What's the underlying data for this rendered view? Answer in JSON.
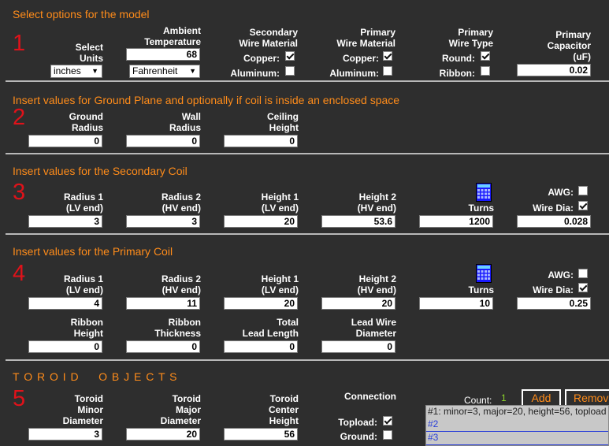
{
  "section1": {
    "title": "Select options for the model",
    "number": "1",
    "units_label": [
      "Select",
      "Units"
    ],
    "units_value": "inches",
    "ambient_label": [
      "Ambient",
      "Temperature"
    ],
    "ambient_value": "68",
    "temp_unit": "Fahrenheit",
    "secondary_material_label": [
      "Secondary",
      "Wire Material"
    ],
    "primary_material_label": [
      "Primary",
      "Wire Material"
    ],
    "primary_type_label": [
      "Primary",
      "Wire Type"
    ],
    "copper": "Copper:",
    "aluminum": "Aluminum:",
    "round": "Round:",
    "ribbon": "Ribbon:",
    "capacitor_label": [
      "Primary",
      "Capacitor",
      "(uF)"
    ],
    "capacitor_value": "0.02"
  },
  "section2": {
    "title": "Insert values for Ground Plane and optionally if coil is inside an enclosed space",
    "number": "2",
    "fields": [
      {
        "label": [
          "Ground",
          "Radius"
        ],
        "value": "0"
      },
      {
        "label": [
          "Wall",
          "Radius"
        ],
        "value": "0"
      },
      {
        "label": [
          "Ceiling",
          "Height"
        ],
        "value": "0"
      }
    ]
  },
  "section3": {
    "title": "Insert values for the Secondary Coil",
    "number": "3",
    "fields": [
      {
        "label": [
          "Radius 1",
          "(LV end)"
        ],
        "value": "3"
      },
      {
        "label": [
          "Radius 2",
          "(HV end)"
        ],
        "value": "3"
      },
      {
        "label": [
          "Height 1",
          "(LV end)"
        ],
        "value": "20"
      },
      {
        "label": [
          "Height 2",
          "(HV end)"
        ],
        "value": "53.6"
      },
      {
        "label": [
          "Turns"
        ],
        "value": "1200"
      }
    ],
    "awg": "AWG:",
    "wire_dia": "Wire Dia:",
    "wire_dia_value": "0.028"
  },
  "section4": {
    "title": "Insert values for the Primary Coil",
    "number": "4",
    "fields": [
      {
        "label": [
          "Radius 1",
          "(LV end)"
        ],
        "value": "4"
      },
      {
        "label": [
          "Radius 2",
          "(HV end)"
        ],
        "value": "11"
      },
      {
        "label": [
          "Height 1",
          "(LV end)"
        ],
        "value": "20"
      },
      {
        "label": [
          "Height 2",
          "(HV end)"
        ],
        "value": "20"
      },
      {
        "label": [
          "Turns"
        ],
        "value": "10"
      }
    ],
    "awg": "AWG:",
    "wire_dia": "Wire Dia:",
    "wire_dia_value": "0.25",
    "fields2": [
      {
        "label": [
          "Ribbon",
          "Height"
        ],
        "value": "0"
      },
      {
        "label": [
          "Ribbon",
          "Thickness"
        ],
        "value": "0"
      },
      {
        "label": [
          "Total",
          "Lead Length"
        ],
        "value": "0"
      },
      {
        "label": [
          "Lead Wire",
          "Diameter"
        ],
        "value": "0"
      }
    ]
  },
  "section5": {
    "title": "T O R O I D     O B J E C T S",
    "number": "5",
    "fields": [
      {
        "label": [
          "Toroid",
          "Minor",
          "Diameter"
        ],
        "value": "3"
      },
      {
        "label": [
          "Toroid",
          "Major",
          "Diameter"
        ],
        "value": "20"
      },
      {
        "label": [
          "Toroid",
          "Center",
          "Height"
        ],
        "value": "56"
      }
    ],
    "connection": "Connection",
    "topload": "Topload:",
    "ground": "Ground:",
    "count_label": "Count:",
    "count_value": "1",
    "add_label": "Add",
    "remove_label": "Remove",
    "list": [
      "#1: minor=3, major=20, height=56, topload",
      "#2",
      "#3"
    ]
  },
  "colors": {
    "background": "#2e2e2e",
    "title": "#ff8c1a",
    "number": "#e0121a",
    "count": "#8cd62a"
  }
}
